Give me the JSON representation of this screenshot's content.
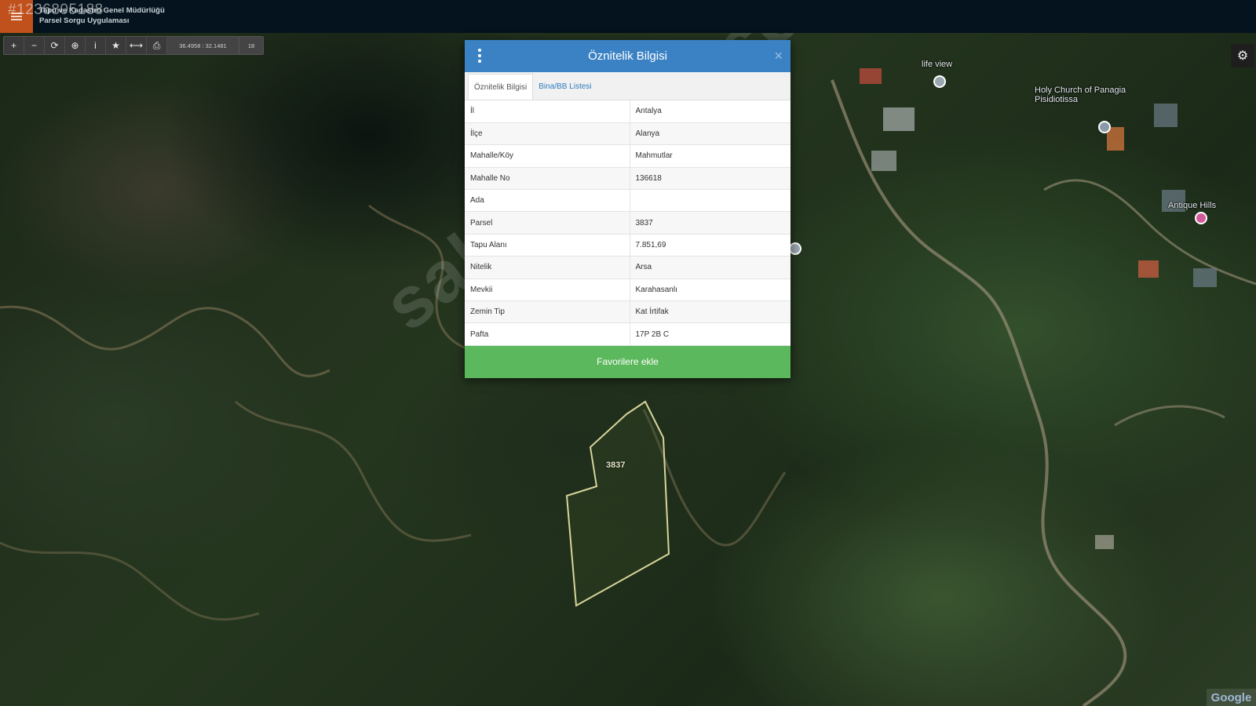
{
  "header": {
    "listing_id": "#1236805188",
    "app_title_line1": "Tapu ve Kadastro Genel Müdürlüğü",
    "app_title_line2": "Parsel Sorgu Uygulaması"
  },
  "toolbar": {
    "tools": [
      {
        "name": "zoom-in-button",
        "glyph": "+"
      },
      {
        "name": "zoom-out-button",
        "glyph": "−"
      },
      {
        "name": "refresh-button",
        "glyph": "⟳"
      },
      {
        "name": "locate-button",
        "glyph": "⊕"
      },
      {
        "name": "info-button",
        "glyph": "i"
      },
      {
        "name": "favorite-button",
        "glyph": "★"
      },
      {
        "name": "measure-button",
        "glyph": "⟷"
      },
      {
        "name": "print-button",
        "glyph": "⎙"
      }
    ],
    "coordinates": "36.4958 : 32.1481",
    "zoom_level": "18"
  },
  "map": {
    "labels": {
      "life_view": "life view",
      "church": "Holy Church of Panagia Pisidiotissa",
      "antique_hills": "Antique Hills"
    },
    "parcel_number": "3837",
    "attribution": "Google",
    "watermark": "sahibinden.com",
    "colors": {
      "parcel_outline": "#d8d49a",
      "road": "#9a8a6a"
    }
  },
  "dialog": {
    "title": "Öznitelik Bilgisi",
    "close_glyph": "×",
    "tabs": [
      {
        "label": "Öznitelik Bilgisi",
        "active": true
      },
      {
        "label": "Bina/BB Listesi",
        "active": false
      }
    ],
    "rows": [
      {
        "key": "İl",
        "value": "Antalya"
      },
      {
        "key": "İlçe",
        "value": "Alanya"
      },
      {
        "key": "Mahalle/Köy",
        "value": "Mahmutlar"
      },
      {
        "key": "Mahalle No",
        "value": "136618"
      },
      {
        "key": "Ada",
        "value": ""
      },
      {
        "key": "Parsel",
        "value": "3837"
      },
      {
        "key": "Tapu Alanı",
        "value": "7.851,69"
      },
      {
        "key": "Nitelik",
        "value": "Arsa"
      },
      {
        "key": "Mevkii",
        "value": "Karahasanlı"
      },
      {
        "key": "Zemin Tip",
        "value": "Kat İrtifak"
      },
      {
        "key": "Pafta",
        "value": "17P 2B C"
      }
    ],
    "favorite_button": "Favorilere ekle",
    "colors": {
      "header": "#3b82c4",
      "button": "#5cb85c"
    }
  }
}
